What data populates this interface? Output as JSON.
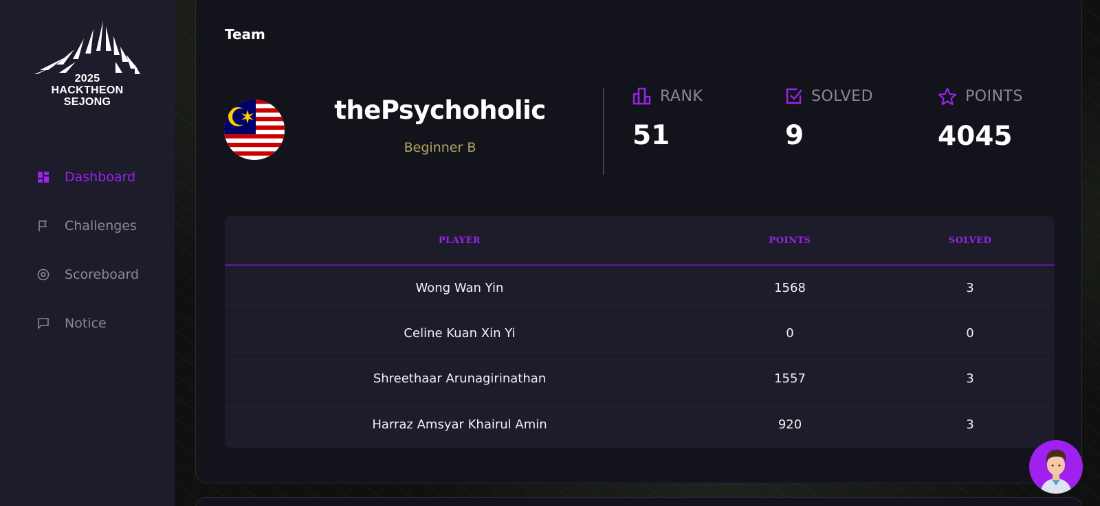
{
  "sidebar": {
    "logo": {
      "line1": "2025",
      "line2": "HACKTHEON",
      "line3": "SEJONG"
    },
    "items": [
      {
        "label": "Dashboard",
        "icon": "dashboard-icon",
        "active": true
      },
      {
        "label": "Challenges",
        "icon": "flag-icon",
        "active": false
      },
      {
        "label": "Scoreboard",
        "icon": "soccer-ball-icon",
        "active": false
      },
      {
        "label": "Notice",
        "icon": "message-icon",
        "active": false
      }
    ]
  },
  "team": {
    "section_title": "Team",
    "flag": "malaysia-flag",
    "name": "thePsychoholic",
    "division": "Beginner B",
    "stats": {
      "rank": {
        "label": "RANK",
        "value": "51",
        "icon": "bar-chart-icon"
      },
      "solved": {
        "label": "SOLVED",
        "value": "9",
        "icon": "checkbox-icon"
      },
      "points": {
        "label": "POINTS",
        "value": "4045",
        "icon": "star-icon"
      }
    }
  },
  "table": {
    "headers": {
      "player": "PLAYER",
      "points": "POINTS",
      "solved": "SOLVED"
    },
    "rows": [
      {
        "player": "Wong Wan Yin",
        "points": "1568",
        "solved": "3"
      },
      {
        "player": "Celine Kuan Xin Yi",
        "points": "0",
        "solved": "0"
      },
      {
        "player": "Shreethaar Arunagirinathan",
        "points": "1557",
        "solved": "3"
      },
      {
        "player": "Harraz Amsyar Khairul Amin",
        "points": "920",
        "solved": "3"
      }
    ]
  },
  "colors": {
    "accent": "#9b24ea",
    "sidebar_bg": "#1c1c2a",
    "card_bg": "#13131b",
    "division_text": "#b3a865",
    "muted_text": "#8a8a96"
  },
  "chat_button": {
    "icon": "user-avatar-icon"
  }
}
